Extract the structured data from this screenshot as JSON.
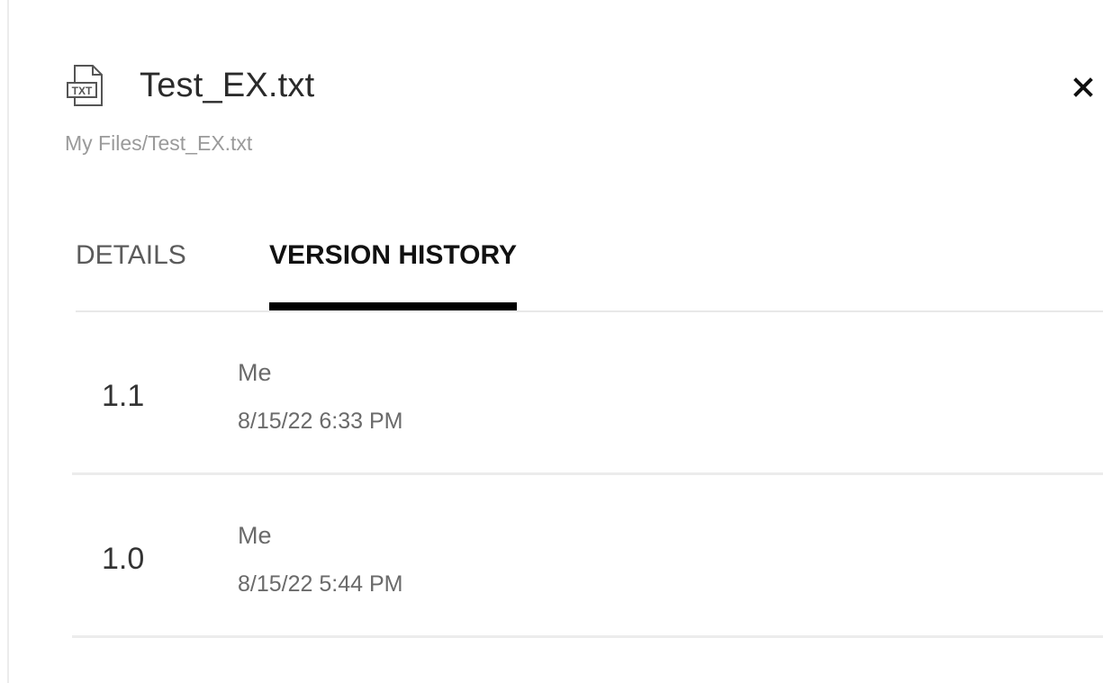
{
  "file": {
    "icon": "txt-file-icon",
    "icon_text": "TXT",
    "name": "Test_EX.txt",
    "path": "My Files/Test_EX.txt"
  },
  "close_icon": "close-icon",
  "tabs": [
    {
      "label": "DETAILS",
      "active": false
    },
    {
      "label": "VERSION HISTORY",
      "active": true
    }
  ],
  "versions": [
    {
      "number": "1.1",
      "user": "Me",
      "date": "8/15/22 6:33 PM"
    },
    {
      "number": "1.0",
      "user": "Me",
      "date": "8/15/22 5:44 PM"
    }
  ],
  "colors": {
    "active_tab_underline": "#000000",
    "secondary_text": "#9a9a9a"
  }
}
